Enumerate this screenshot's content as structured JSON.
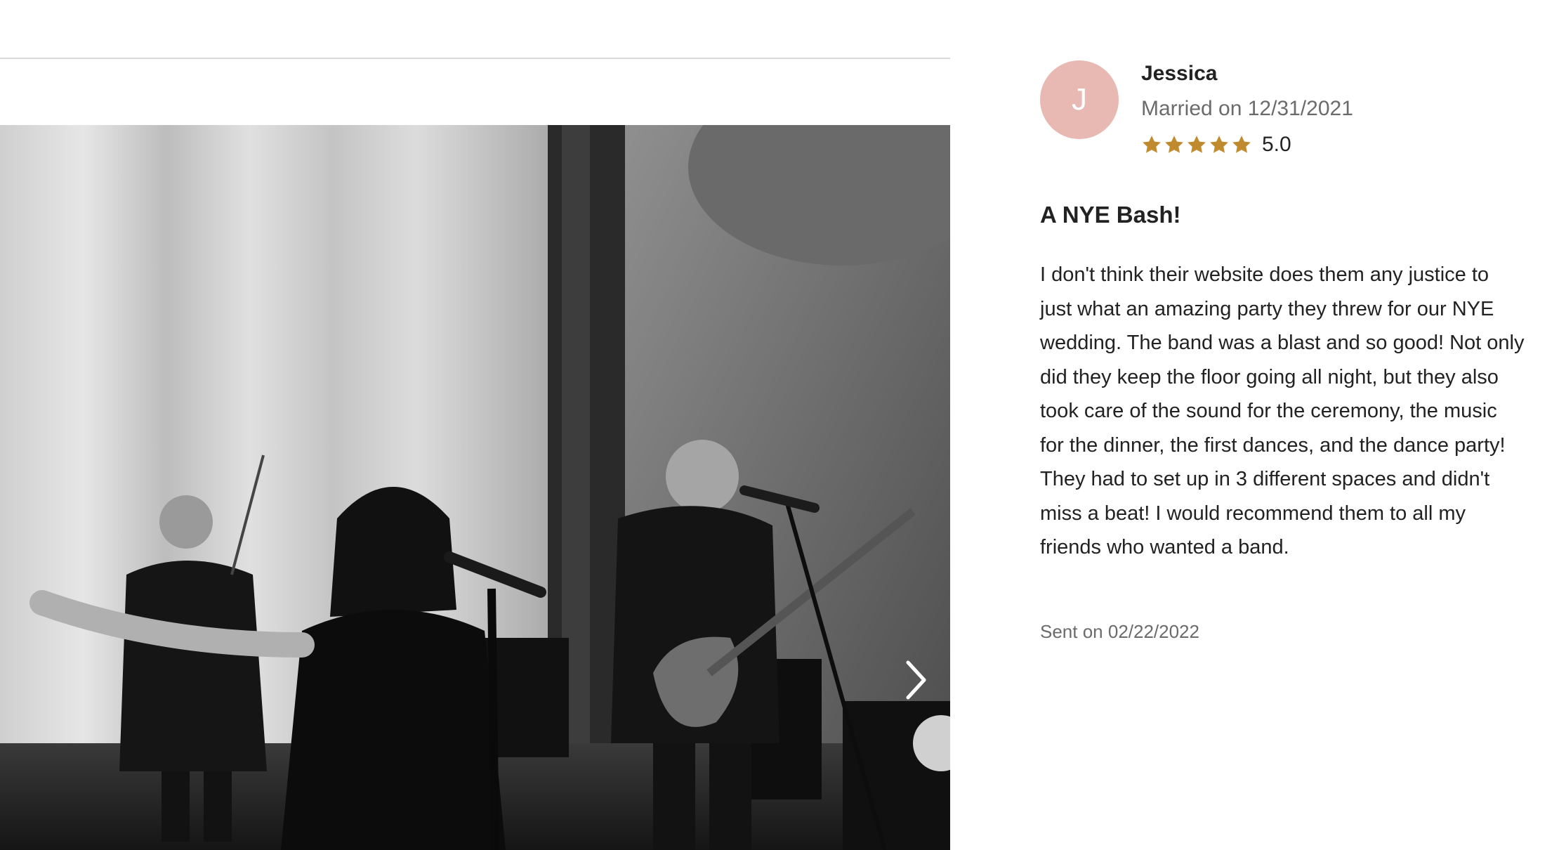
{
  "gallery": {
    "next_icon": "chevron-right-icon"
  },
  "review": {
    "avatar_initial": "J",
    "avatar_color": "#e8b9b2",
    "reviewer_name": "Jessica",
    "married_on": "Married on 12/31/2021",
    "rating_stars": 5,
    "star_color": "#c08a2e",
    "rating_value": "5.0",
    "title": "A NYE Bash!",
    "body": "I don't think their website does them any justice to just what an amazing party they threw for our NYE wedding. The band was a blast and so good! Not only did they keep the floor going all night, but they also took care of the sound for the ceremony, the music for the dinner, the first dances, and the dance party! They had to set up in 3 different spaces and didn't miss a beat! I would recommend them to all my friends who wanted a band.",
    "sent_on": "Sent on 02/22/2022"
  }
}
